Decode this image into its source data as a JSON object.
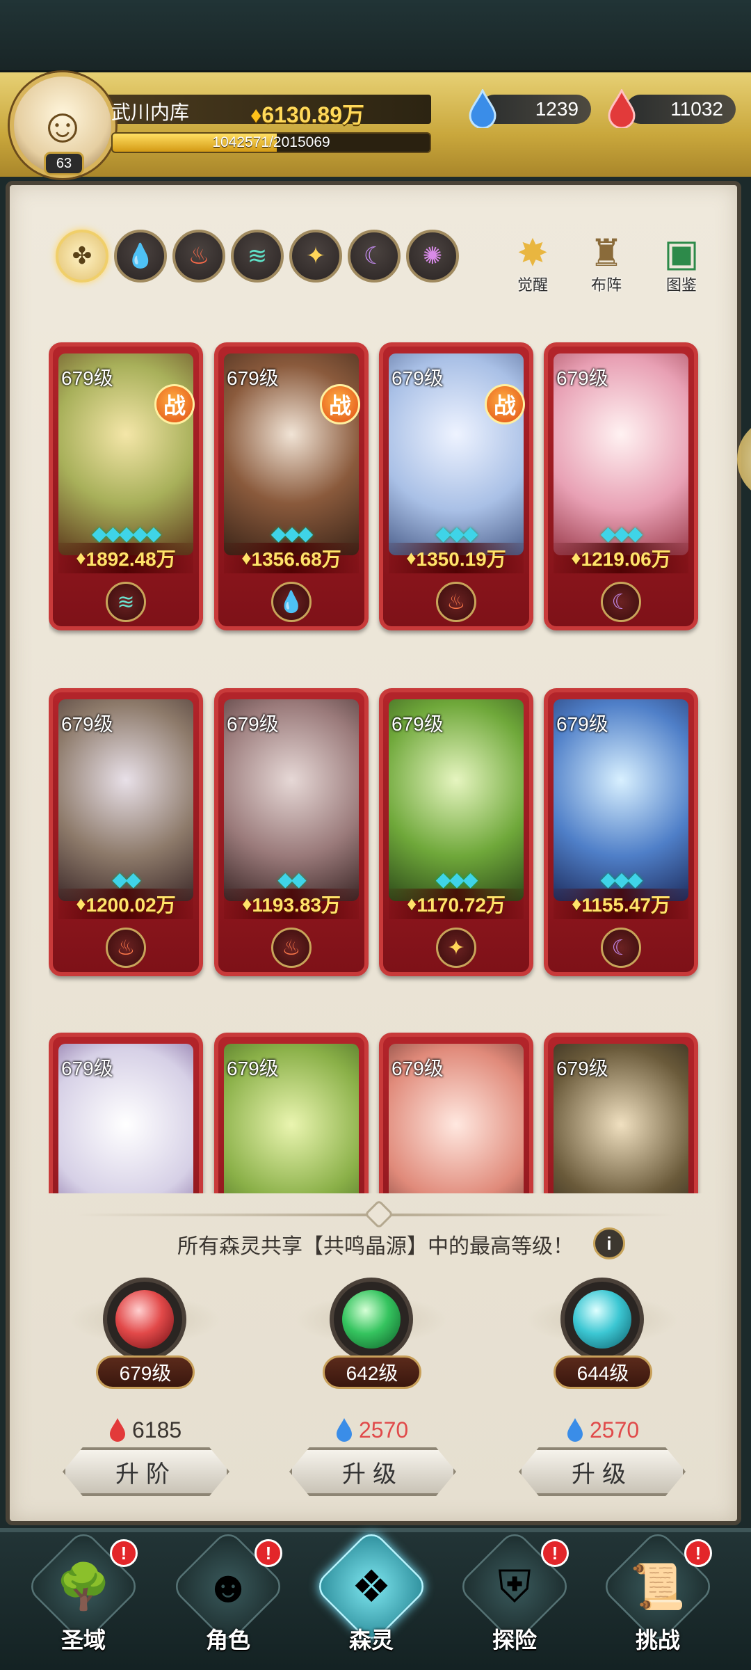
{
  "player": {
    "name": "武川内库",
    "level": "63",
    "gold": "6130.89万",
    "exp_text": "1042571/2015069",
    "exp_fraction": 0.5176
  },
  "resources": {
    "blue_drops": "1239",
    "red_drops": "11032"
  },
  "element_tabs": [
    {
      "name": "all",
      "icon": "all-icon"
    },
    {
      "name": "water",
      "icon": "water-icon"
    },
    {
      "name": "fire",
      "icon": "fire-icon"
    },
    {
      "name": "wind",
      "icon": "wind-icon"
    },
    {
      "name": "light",
      "icon": "light-icon"
    },
    {
      "name": "dark",
      "icon": "moon-icon"
    },
    {
      "name": "chaos",
      "icon": "swirl-icon"
    }
  ],
  "top_buttons": {
    "awaken": "觉醒",
    "formation": "布阵",
    "codex": "图鉴"
  },
  "cards": [
    {
      "level": "679级",
      "battle": "战",
      "stars": 5,
      "power": "1892.48万",
      "element": "wind"
    },
    {
      "level": "679级",
      "battle": "战",
      "stars": 3,
      "power": "1356.68万",
      "element": "water"
    },
    {
      "level": "679级",
      "battle": "战",
      "stars": 3,
      "power": "1350.19万",
      "element": "fire"
    },
    {
      "level": "679级",
      "battle": "",
      "stars": 3,
      "power": "1219.06万",
      "element": "dark"
    },
    {
      "level": "679级",
      "battle": "",
      "stars": 2,
      "power": "1200.02万",
      "element": "fire"
    },
    {
      "level": "679级",
      "battle": "",
      "stars": 2,
      "power": "1193.83万",
      "element": "fire"
    },
    {
      "level": "679级",
      "battle": "",
      "stars": 3,
      "power": "1170.72万",
      "element": "light"
    },
    {
      "level": "679级",
      "battle": "",
      "stars": 3,
      "power": "1155.47万",
      "element": "dark"
    },
    {
      "level": "679级",
      "battle": "",
      "stars": 0,
      "power": "",
      "element": ""
    },
    {
      "level": "679级",
      "battle": "",
      "stars": 0,
      "power": "",
      "element": ""
    },
    {
      "level": "679级",
      "battle": "",
      "stars": 0,
      "power": "",
      "element": ""
    },
    {
      "level": "679级",
      "battle": "",
      "stars": 0,
      "power": "",
      "element": ""
    }
  ],
  "resonance_info": "所有森灵共享【共鸣晶源】中的最高等级！",
  "crystals": [
    {
      "level": "679级",
      "cost": "6185",
      "cost_icon": "red-drop-icon",
      "button": "升阶"
    },
    {
      "level": "642级",
      "cost": "2570",
      "cost_icon": "blue-drop-icon",
      "button": "升级"
    },
    {
      "level": "644级",
      "cost": "2570",
      "cost_icon": "blue-drop-icon",
      "button": "升级"
    }
  ],
  "nav": [
    {
      "label": "圣域",
      "badge": "!"
    },
    {
      "label": "角色",
      "badge": "!"
    },
    {
      "label": "森灵",
      "badge": ""
    },
    {
      "label": "探险",
      "badge": "!"
    },
    {
      "label": "挑战",
      "badge": "!"
    }
  ],
  "colors": {
    "accent_gold": "#ffd95a",
    "card_red": "#b3242a",
    "panel": "#efe9dc",
    "nav_bg": "#1c2a2b"
  }
}
